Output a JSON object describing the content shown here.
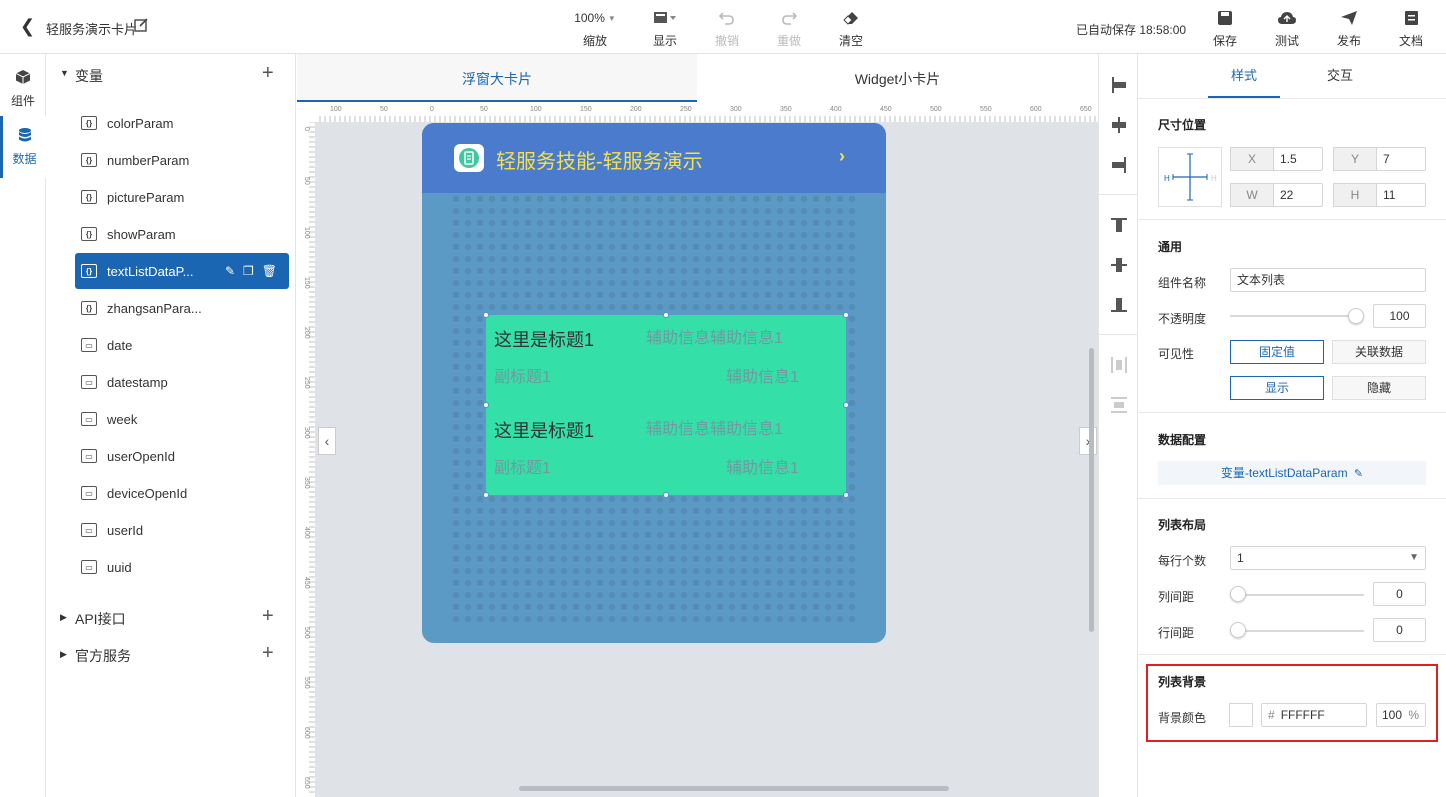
{
  "topbar": {
    "title": "轻服务演示卡片",
    "tools": [
      {
        "label": "缩放",
        "value": "100%"
      },
      {
        "label": "显示"
      },
      {
        "label": "撤销"
      },
      {
        "label": "重做"
      },
      {
        "label": "清空"
      }
    ],
    "autosave": "已自动保存 18:58:00",
    "actions": [
      "保存",
      "测试",
      "发布",
      "文档"
    ]
  },
  "rail": {
    "items": [
      "组件",
      "数据"
    ]
  },
  "variables": {
    "header": "变量",
    "items": [
      "colorParam",
      "numberParam",
      "pictureParam",
      "showParam",
      "textListDataP...",
      "zhangsanPara...",
      "date",
      "datestamp",
      "week",
      "userOpenId",
      "deviceOpenId",
      "userId",
      "uuid"
    ],
    "sections": [
      "API接口",
      "官方服务"
    ]
  },
  "canvas": {
    "tabs": [
      "浮窗大卡片",
      "Widget小卡片"
    ],
    "ruler_h": [
      "100",
      "50",
      "0",
      "50",
      "100",
      "150",
      "200",
      "250",
      "300",
      "350",
      "400",
      "450",
      "500",
      "550",
      "600",
      "650"
    ],
    "ruler_v": [
      "0",
      "50",
      "100",
      "150",
      "200",
      "250",
      "300",
      "350",
      "400",
      "450",
      "500",
      "550",
      "600",
      "650"
    ],
    "card_title": "轻服务技能-轻服务演示",
    "list_items": [
      {
        "title": "这里是标题1",
        "aux1": "辅助信息辅助信息1",
        "subtitle": "副标题1",
        "aux2": "辅助信息1"
      },
      {
        "title": "这里是标题1",
        "aux1": "辅助信息辅助信息1",
        "subtitle": "副标题1",
        "aux2": "辅助信息1"
      }
    ],
    "list_bg": "#34e0a8",
    "card_bg": "#5b9ac4",
    "card_head_bg": "#4a7bcc"
  },
  "right": {
    "tabs": [
      "样式",
      "交互"
    ],
    "size": {
      "title": "尺寸位置",
      "x_label": "X",
      "x": "1.5",
      "y_label": "Y",
      "y": "7",
      "w_label": "W",
      "w": "22",
      "h_label": "H",
      "h": "11"
    },
    "general": {
      "title": "通用",
      "name_label": "组件名称",
      "name": "文本列表",
      "opacity_label": "不透明度",
      "opacity": "100",
      "visibility_label": "可见性",
      "vis_opts": [
        "固定值",
        "关联数据"
      ],
      "show_opts": [
        "显示",
        "隐藏"
      ]
    },
    "data": {
      "title": "数据配置",
      "binding": "变量-textListDataParam"
    },
    "layout": {
      "title": "列表布局",
      "per_row_label": "每行个数",
      "per_row": "1",
      "col_gap_label": "列间距",
      "col_gap": "0",
      "row_gap_label": "行间距",
      "row_gap": "0"
    },
    "bg": {
      "title": "列表背景",
      "color_label": "背景颜色",
      "hash": "#",
      "hex": "FFFFFF",
      "alpha": "100",
      "pct": "%"
    }
  },
  "accent": "#1a66b3"
}
